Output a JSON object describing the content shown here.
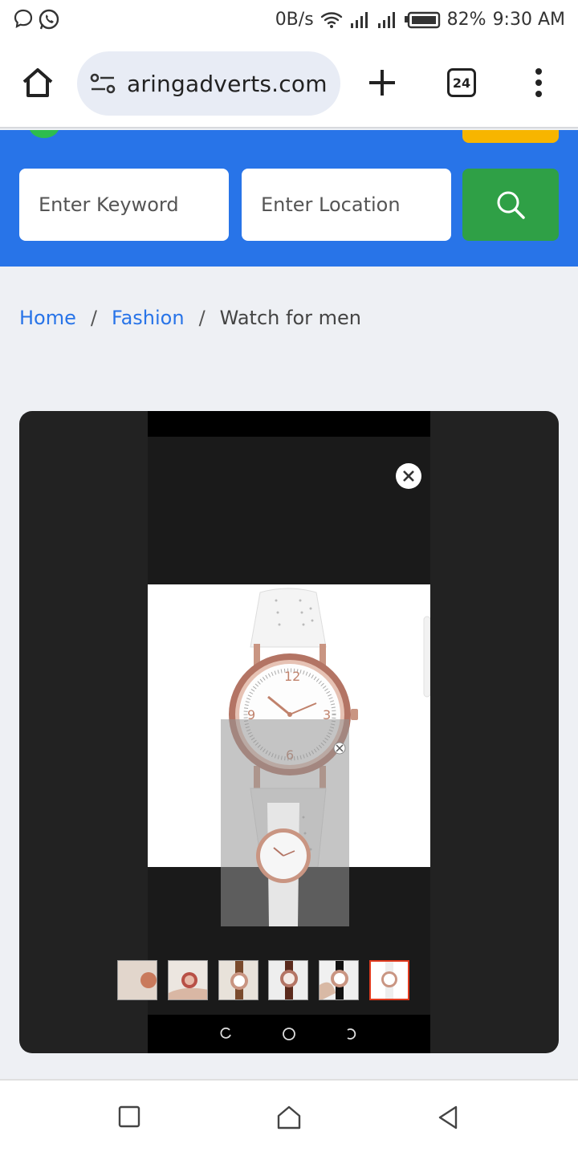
{
  "status_bar": {
    "speed": "0B/s",
    "battery": "82%",
    "time": "9:30 AM"
  },
  "browser": {
    "url": "aringadverts.com",
    "tab_count": "24"
  },
  "search": {
    "keyword_placeholder": "Enter Keyword",
    "location_placeholder": "Enter Location"
  },
  "breadcrumb": {
    "home": "Home",
    "category": "Fashion",
    "current": "Watch for men",
    "separator": "/"
  },
  "gallery": {
    "thumbnail_count": 6,
    "active_thumbnail_index": 5
  },
  "colors": {
    "brand_blue": "#2874e8",
    "search_green": "#2fa046",
    "accent_yellow": "#f7b500"
  }
}
